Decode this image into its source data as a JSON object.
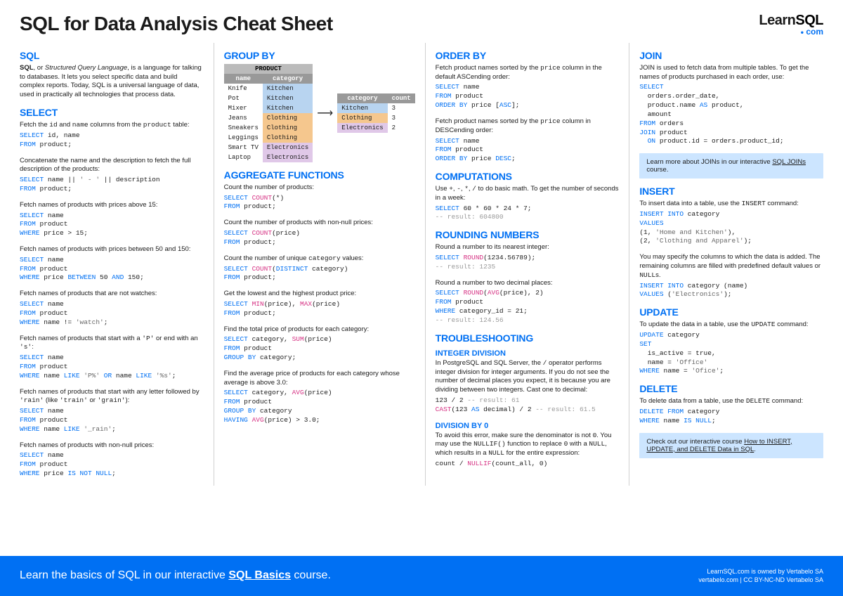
{
  "title": "SQL for Data Analysis Cheat Sheet",
  "logo": {
    "learn": "Learn",
    "sql": "SQL",
    "com": "com"
  },
  "col1": {
    "sql_h": "SQL",
    "sql_p": "<strong>SQL</strong>, or <em>Structured Query Language</em>, is a language for talking to databases. It lets you select specific data and build complex reports. Today, SQL is a universal language of data, used in practically all technologies that process data.",
    "select_h": "SELECT",
    "s1_p": "Fetch the <code>id</code> and <code>name</code> columns from the <code>product</code> table:",
    "s1_c": "<span class='kw'>SELECT</span> id, name\n<span class='kw'>FROM</span> product;",
    "s2_p": "Concatenate the name and the description to fetch the full description of the products:",
    "s2_c": "<span class='kw'>SELECT</span> name || <span class='str'>' - '</span> || description\n<span class='kw'>FROM</span> product;",
    "s3_p": "Fetch names of products with prices above 15:",
    "s3_c": "<span class='kw'>SELECT</span> name\n<span class='kw'>FROM</span> product\n<span class='kw'>WHERE</span> price > 15;",
    "s4_p": "Fetch names of products with prices between 50 and 150:",
    "s4_c": "<span class='kw'>SELECT</span> name\n<span class='kw'>FROM</span> product\n<span class='kw'>WHERE</span> price <span class='kw'>BETWEEN</span> 50 <span class='kw'>AND</span> 150;",
    "s5_p": "Fetch names of products that are not watches:",
    "s5_c": "<span class='kw'>SELECT</span> name\n<span class='kw'>FROM</span> product\n<span class='kw'>WHERE</span> name != <span class='str'>'watch'</span>;",
    "s6_p": "Fetch names of products that start with a <code>'P'</code> or end with an <code>'s'</code>:",
    "s6_c": "<span class='kw'>SELECT</span> name\n<span class='kw'>FROM</span> product\n<span class='kw'>WHERE</span> name <span class='kw'>LIKE</span> <span class='str'>'P%'</span> <span class='kw'>OR</span> name <span class='kw'>LIKE</span> <span class='str'>'%s'</span>;",
    "s7_p": "Fetch names of products that start with any letter followed by <code>'rain'</code> (like <code>'train'</code> or <code>'grain'</code>):",
    "s7_c": "<span class='kw'>SELECT</span> name\n<span class='kw'>FROM</span> product\n<span class='kw'>WHERE</span> name <span class='kw'>LIKE</span> <span class='str'>'_rain'</span>;",
    "s8_p": "Fetch names of products with non-null prices:",
    "s8_c": "<span class='kw'>SELECT</span> name\n<span class='kw'>FROM</span> product\n<span class='kw'>WHERE</span> price <span class='kw'>IS NOT NULL</span>;"
  },
  "col2": {
    "gb_h": "GROUP BY",
    "tbl_product": "PRODUCT",
    "th_name": "name",
    "th_cat": "category",
    "th_count": "count",
    "rows": [
      [
        "Knife",
        "Kitchen",
        "c-kitchen"
      ],
      [
        "Pot",
        "Kitchen",
        "c-kitchen"
      ],
      [
        "Mixer",
        "Kitchen",
        "c-kitchen"
      ],
      [
        "Jeans",
        "Clothing",
        "c-clothing"
      ],
      [
        "Sneakers",
        "Clothing",
        "c-clothing"
      ],
      [
        "Leggings",
        "Clothing",
        "c-clothing"
      ],
      [
        "Smart TV",
        "Electronics",
        "c-elec"
      ],
      [
        "Laptop",
        "Electronics",
        "c-elec"
      ]
    ],
    "res": [
      [
        "Kitchen",
        "3",
        "c-kitchen"
      ],
      [
        "Clothing",
        "3",
        "c-clothing"
      ],
      [
        "Electronics",
        "2",
        "c-elec"
      ]
    ],
    "agg_h": "AGGREGATE FUNCTIONS",
    "a1_p": "Count the number of products:",
    "a1_c": "<span class='kw'>SELECT</span> <span class='fn'>COUNT</span>(*)\n<span class='kw'>FROM</span> product;",
    "a2_p": "Count the number of products with non-null prices:",
    "a2_c": "<span class='kw'>SELECT</span> <span class='fn'>COUNT</span>(price)\n<span class='kw'>FROM</span> product;",
    "a3_p": "Count the number of unique <code>category</code> values:",
    "a3_c": "<span class='kw'>SELECT</span> <span class='fn'>COUNT</span>(<span class='kw'>DISTINCT</span> category)\n<span class='kw'>FROM</span> product;",
    "a4_p": "Get the lowest and the highest product price:",
    "a4_c": "<span class='kw'>SELECT</span> <span class='fn'>MIN</span>(price), <span class='fn'>MAX</span>(price)\n<span class='kw'>FROM</span> product;",
    "a5_p": "Find the total price of products for each category:",
    "a5_c": "<span class='kw'>SELECT</span> category, <span class='fn'>SUM</span>(price)\n<span class='kw'>FROM</span> product\n<span class='kw'>GROUP BY</span> category;",
    "a6_p": "Find the average price of products for each category whose average is above 3.0:",
    "a6_c": "<span class='kw'>SELECT</span> category, <span class='fn'>AVG</span>(price)\n<span class='kw'>FROM</span> product\n<span class='kw'>GROUP BY</span> category\n<span class='kw'>HAVING</span> <span class='fn'>AVG</span>(price) > 3.0;"
  },
  "col3": {
    "ob_h": "ORDER BY",
    "o1_p": "Fetch product names sorted by the <code>price</code> column in the default ASCending order:",
    "o1_c": "<span class='kw'>SELECT</span> name\n<span class='kw'>FROM</span> product\n<span class='kw'>ORDER BY</span> price [<span class='kw'>ASC</span>];",
    "o2_p": "Fetch product names sorted by the <code>price</code> column in DESCending order:",
    "o2_c": "<span class='kw'>SELECT</span> name\n<span class='kw'>FROM</span> product\n<span class='kw'>ORDER BY</span> price <span class='kw'>DESC</span>;",
    "comp_h": "COMPUTATIONS",
    "c1_p": "Use <code>+</code>, <code>-</code>, <code>*</code>, <code>/</code> to do basic math. To get the number of seconds in a week:",
    "c1_c": "<span class='kw'>SELECT</span> 60 * 60 * 24 * 7;\n<span class='gray'>-- result: 604800</span>",
    "rn_h": "ROUNDING NUMBERS",
    "r1_p": "Round a number to its nearest integer:",
    "r1_c": "<span class='kw'>SELECT</span> <span class='fn'>ROUND</span>(1234.56789);\n<span class='gray'>-- result: 1235</span>",
    "r2_p": "Round a number to two decimal places:",
    "r2_c": "<span class='kw'>SELECT</span> <span class='fn'>ROUND</span>(<span class='fn'>AVG</span>(price), 2)\n<span class='kw'>FROM</span> product\n<span class='kw'>WHERE</span> category_id = 21;\n<span class='gray'>-- result: 124.56</span>",
    "ts_h": "TROUBLESHOOTING",
    "id_h": "INTEGER DIVISION",
    "id_p": "In PostgreSQL and SQL Server, the <code>/</code> operator performs integer division for integer arguments. If you do not see the number of decimal places you expect, it is because you are dividing between two integers. Cast one to decimal:",
    "id_c": "123 / 2 <span class='gray'>-- result: 61</span>\n<span class='fn'>CAST</span>(123 <span class='kw'>AS</span> decimal) / 2 <span class='gray'>-- result: 61.5</span>",
    "d0_h": "DIVISION BY 0",
    "d0_p": "To avoid this error, make sure the denominator is not <code>0</code>. You may use the <code>NULLIF()</code> function to replace <code>0</code> with a <code>NULL</code>, which results in a <code>NULL</code> for the entire expression:",
    "d0_c": "count / <span class='fn'>NULLIF</span>(count_all, 0)"
  },
  "col4": {
    "j_h": "JOIN",
    "j_p": "JOIN is used to fetch data from multiple tables. To get the names of products purchased in each order, use:",
    "j_c": "<span class='kw'>SELECT</span>\n  orders.order_date,\n  product.name <span class='kw'>AS</span> product,\n  amount\n<span class='kw'>FROM</span> orders\n<span class='kw'>JOIN</span> product\n  <span class='kw'>ON</span> product.id = orders.product_id;",
    "j_call": "Learn more about JOINs in our interactive <a href='#'>SQL JOINs</a> course.",
    "i_h": "INSERT",
    "i1_p": "To insert data into a table, use the <code>INSERT</code> command:",
    "i1_c": "<span class='kw'>INSERT INTO</span> category\n<span class='kw'>VALUES</span>\n(1, <span class='str'>'Home and Kitchen'</span>),\n(2, <span class='str'>'Clothing and Apparel'</span>);",
    "i2_p": "You may specify the columns to which the data is added. The remaining columns are filled with predefined default values or <code>NULL</code>s.",
    "i2_c": "<span class='kw'>INSERT INTO</span> category (name)\n<span class='kw'>VALUES</span> (<span class='str'>'Electronics'</span>);",
    "u_h": "UPDATE",
    "u_p": "To update the data in a table, use the <code>UPDATE</code> command:",
    "u_c": "<span class='kw'>UPDATE</span> category\n<span class='kw'>SET</span>\n  is_active = true,\n  name = <span class='str'>'Office'</span>\n<span class='kw'>WHERE</span> name = <span class='str'>'Ofice'</span>;",
    "d_h": "DELETE",
    "d_p": "To delete data from a table, use the <code>DELETE</code> command:",
    "d_c": "<span class='kw'>DELETE FROM</span> category\n<span class='kw'>WHERE</span> name <span class='kw'>IS NULL</span>;",
    "d_call": "Check out our interactive course <a href='#'>How to INSERT, UPDATE, and DELETE Data in SQL</a>."
  },
  "footer": {
    "left": "Learn the basics of SQL in our interactive <strong>SQL Basics</strong> course.",
    "r1": "LearnSQL.com is owned by Vertabelo SA",
    "r2": "vertabelo.com | CC BY-NC-ND Vertabelo SA"
  }
}
